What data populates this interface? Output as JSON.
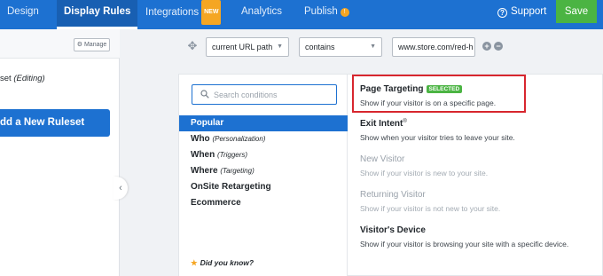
{
  "topbar": {
    "tabs": [
      {
        "label": "Design"
      },
      {
        "label": "Display Rules"
      },
      {
        "label": "Integrations",
        "badge": "NEW"
      },
      {
        "label": "Analytics"
      },
      {
        "label": "Publish",
        "badge": "!"
      }
    ],
    "support_label": "Support",
    "save_label": "Save"
  },
  "left_panel": {
    "manage_label": "Manage",
    "ruleset_name": "set",
    "ruleset_status": "(Editing)",
    "add_ruleset_label": "dd a New Ruleset",
    "collapse_glyph": "‹"
  },
  "condition_row": {
    "field": "current URL path",
    "operator": "contains",
    "value": "www.store.com/red-h",
    "add_glyph": "+",
    "remove_glyph": "−"
  },
  "search": {
    "placeholder": "Search conditions"
  },
  "categories": [
    {
      "label": "Popular",
      "sub": ""
    },
    {
      "label": "Who",
      "sub": "(Personalization)"
    },
    {
      "label": "When",
      "sub": "(Triggers)"
    },
    {
      "label": "Where",
      "sub": "(Targeting)"
    },
    {
      "label": "OnSite Retargeting",
      "sub": ""
    },
    {
      "label": "Ecommerce",
      "sub": ""
    }
  ],
  "did_you_know": "Did you know?",
  "options": [
    {
      "title": "Page Targeting",
      "badge": "SELECTED",
      "desc": "Show if your visitor is on a specific page."
    },
    {
      "title": "Exit Intent",
      "sup": "®",
      "desc": "Show when your visitor tries to leave your site."
    },
    {
      "title": "New Visitor",
      "desc": "Show if your visitor is new to your site."
    },
    {
      "title": "Returning Visitor",
      "desc": "Show if your visitor is not new to your site."
    },
    {
      "title": "Visitor's Device",
      "desc": "Show if your visitor is browsing your site with a specific device."
    }
  ],
  "colors": {
    "primary": "#1d71d1",
    "save": "#4bb443",
    "badge_orange": "#f5a623",
    "highlight": "#d7262e"
  }
}
